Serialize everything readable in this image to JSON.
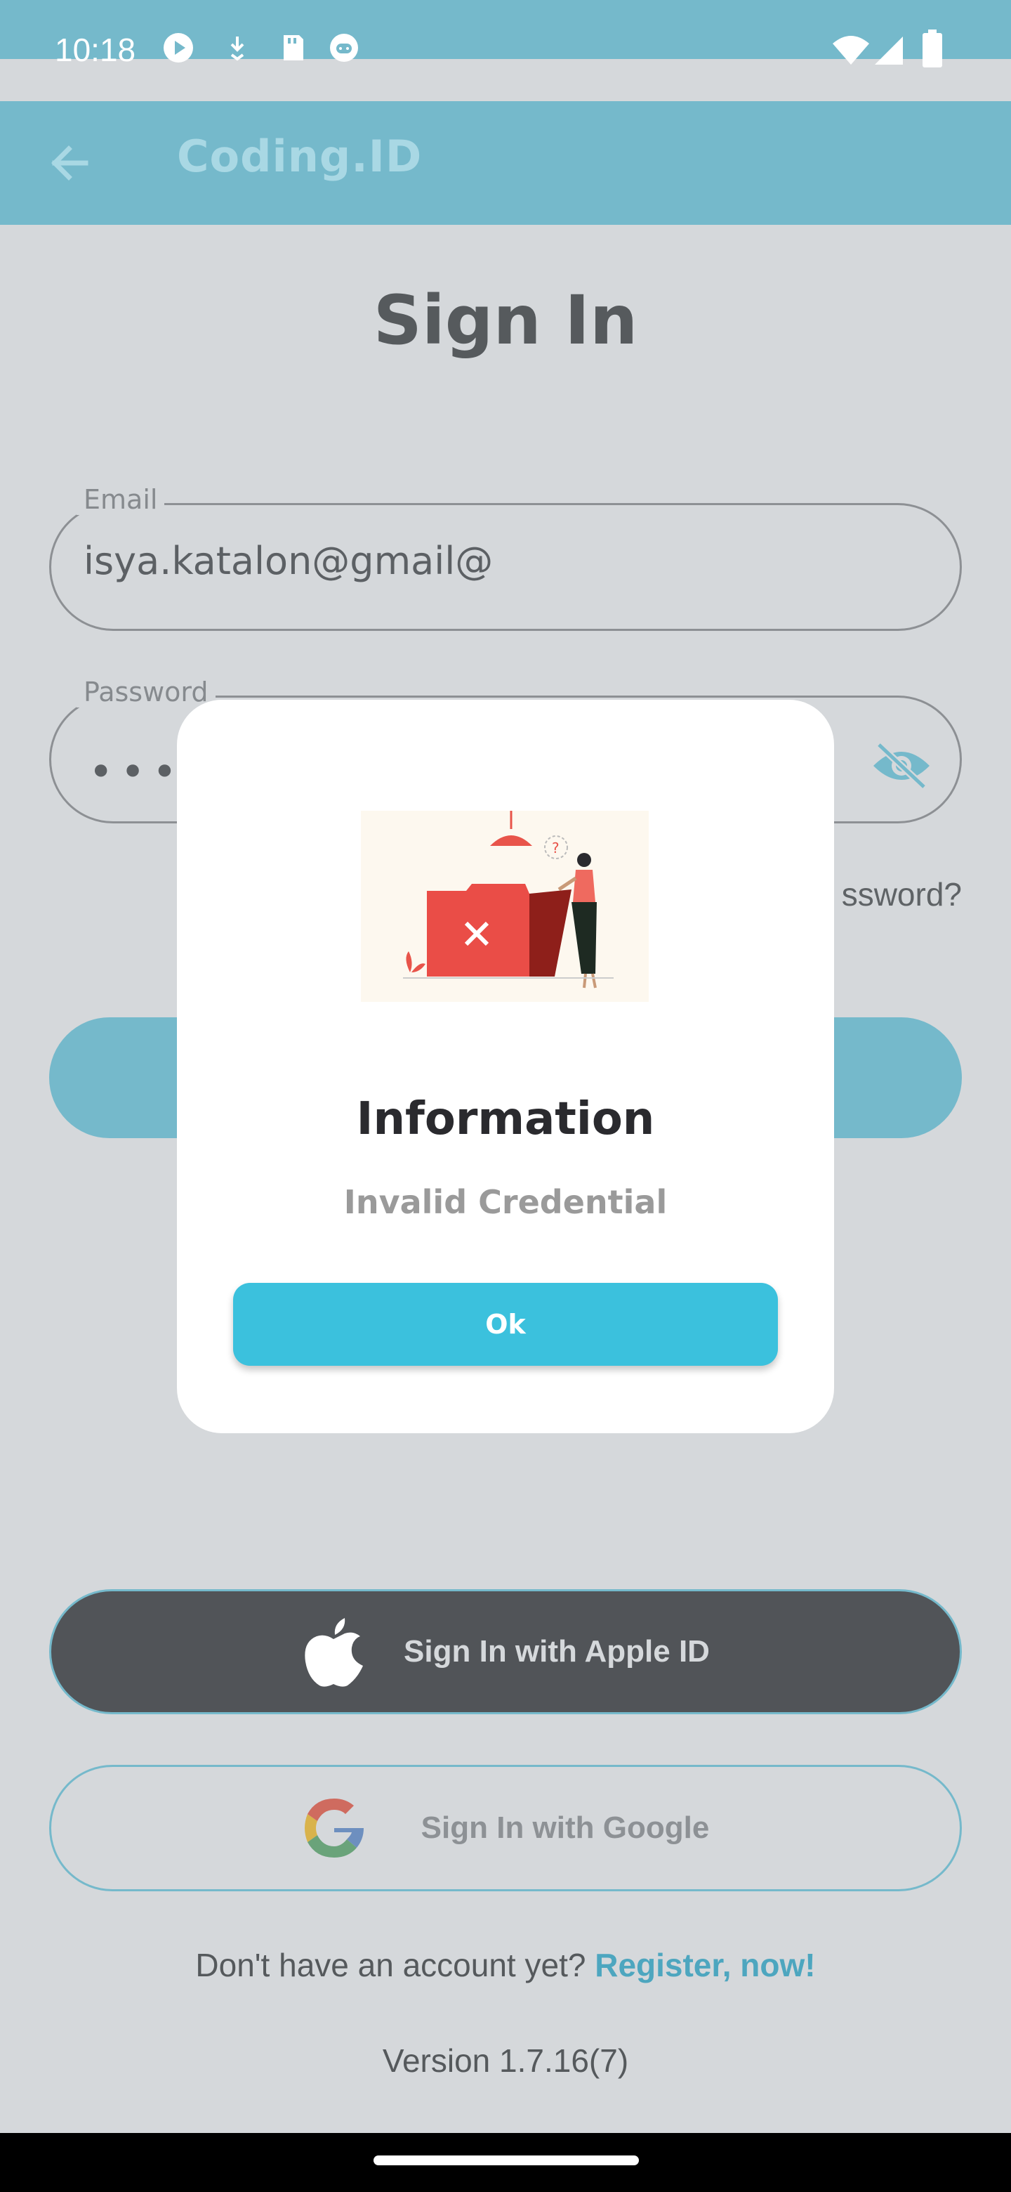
{
  "status_bar": {
    "time": "10:18",
    "icons_left": [
      "media-app-icon",
      "download-icon",
      "sd-card-icon",
      "android-icon"
    ],
    "icons_right": [
      "wifi-icon",
      "signal-icon",
      "battery-icon"
    ]
  },
  "app_bar": {
    "title": "Coding.ID",
    "back_icon": "arrow-left-icon"
  },
  "form": {
    "heading": "Sign In",
    "email_label": "Email",
    "email_value": "isya.katalon@gmail@",
    "password_label": "Password",
    "password_masked": "••••",
    "forgot_text": "ssword?",
    "apple_label": "Sign In with Apple ID",
    "google_label": "Sign In with Google",
    "register_prompt": "Don't have an account yet?",
    "register_link": "Register, now!",
    "version": "Version 1.7.16(7)"
  },
  "dialog": {
    "title": "Information",
    "message": "Invalid Credential",
    "ok_label": "Ok"
  },
  "colors": {
    "accent": "#75b9cb",
    "dialog_button": "#3bc1dd",
    "overlay": "#d5d8db"
  }
}
